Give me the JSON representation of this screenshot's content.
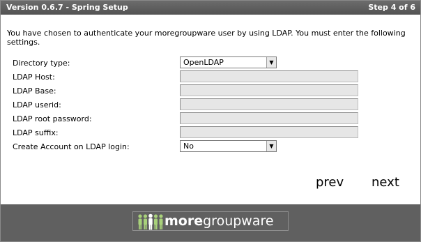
{
  "header": {
    "title": "Version 0.6.7 - Spring Setup",
    "step": "Step 4 of 6"
  },
  "intro": "You have chosen to authenticate your moregroupware user by using LDAP. You must enter the following settings.",
  "form": {
    "directory_type": {
      "label": "Directory type:",
      "value": "OpenLDAP"
    },
    "ldap_host": {
      "label": "LDAP Host:",
      "value": ""
    },
    "ldap_base": {
      "label": "LDAP Base:",
      "value": ""
    },
    "ldap_userid": {
      "label": "LDAP userid:",
      "value": ""
    },
    "ldap_root_password": {
      "label": "LDAP root password:",
      "value": ""
    },
    "ldap_suffix": {
      "label": "LDAP suffix:",
      "value": ""
    },
    "create_account": {
      "label": "Create Account on LDAP login:",
      "value": "No"
    }
  },
  "nav": {
    "prev": "prev",
    "next": "next"
  },
  "footer": {
    "logo_bold": "more",
    "logo_rest": "groupware",
    "logo_icon": "people-group-icon"
  },
  "colors": {
    "titlebar": "#5e5e5e",
    "footer": "#606060",
    "field_bg": "#e6e6e6",
    "logo_people": "#a8d17a"
  }
}
